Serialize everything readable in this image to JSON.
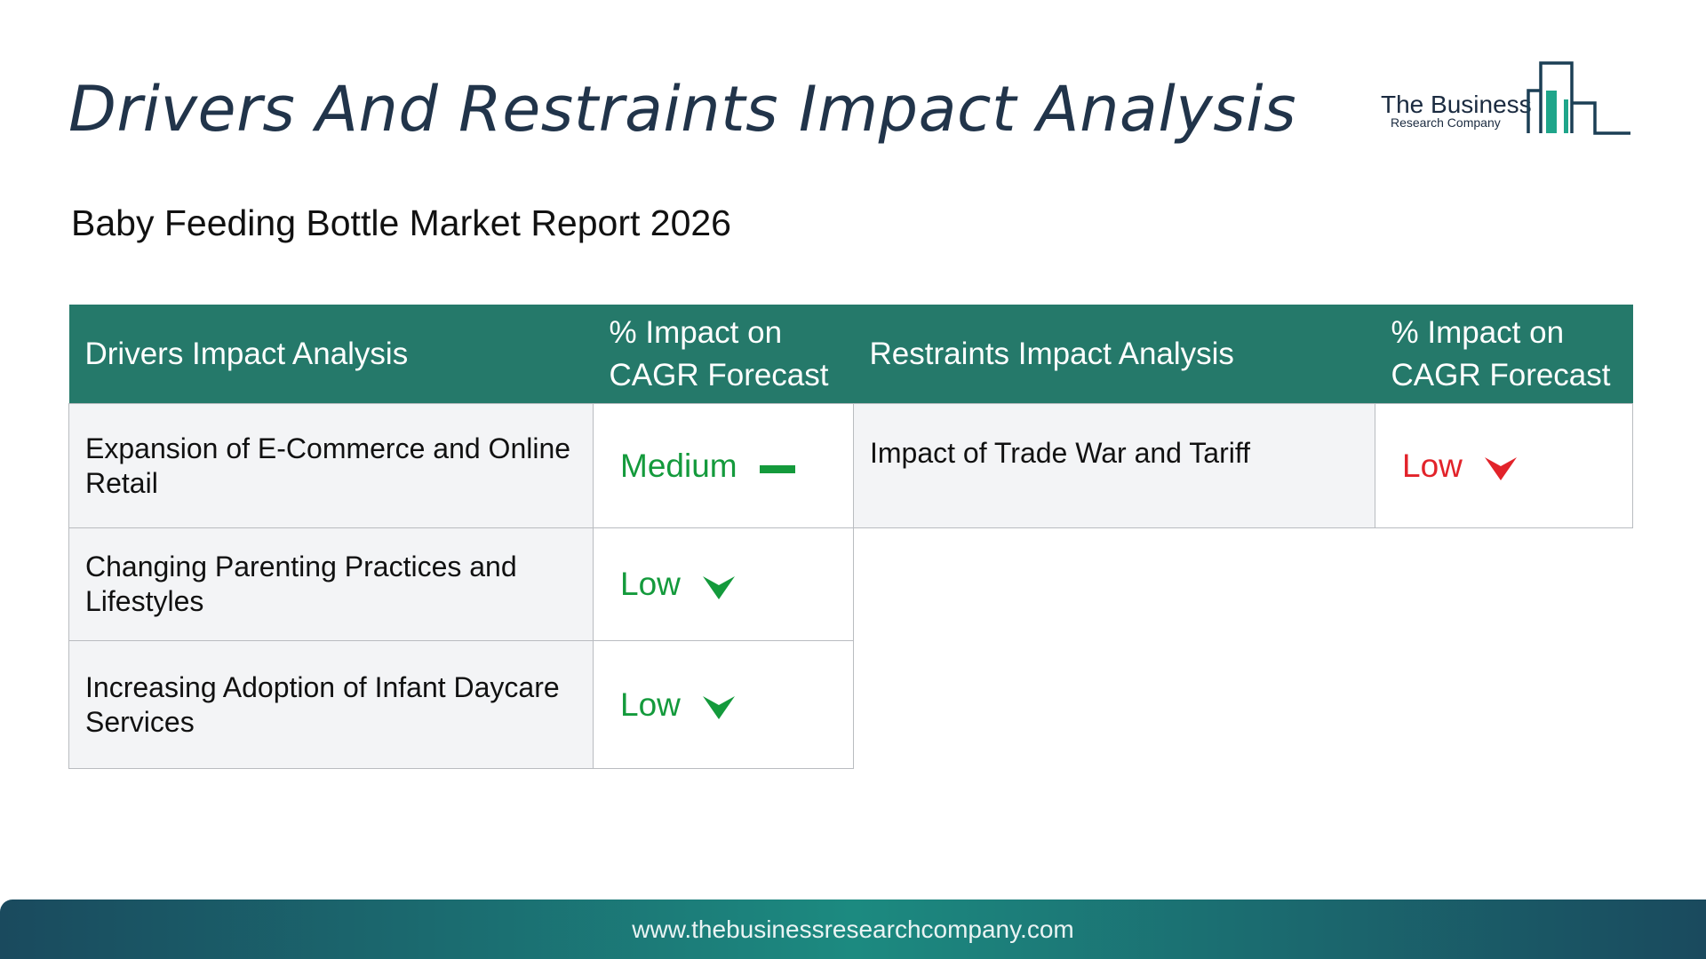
{
  "page_title": "Drivers And Restraints Impact Analysis",
  "subtitle": "Baby Feeding Bottle Market Report 2026",
  "logo": {
    "line1": "The Business",
    "line2": "Research Company"
  },
  "drivers": {
    "header": "Drivers Impact Analysis",
    "impact_header": "% Impact on CAGR Forecast",
    "rows": [
      {
        "factor": "Expansion of E-Commerce and Online Retail",
        "impact": "Medium",
        "indicator": "dash-icon"
      },
      {
        "factor": "Changing Parenting Practices and Lifestyles",
        "impact": "Low",
        "indicator": "arrow-down-icon"
      },
      {
        "factor": "Increasing Adoption of Infant Daycare Services",
        "impact": "Low",
        "indicator": "arrow-down-icon"
      }
    ]
  },
  "restraints": {
    "header": "Restraints Impact Analysis",
    "impact_header": "% Impact on CAGR Forecast",
    "rows": [
      {
        "factor": "Impact of Trade War and Tariff",
        "impact": "Low",
        "indicator": "arrow-down-icon"
      }
    ]
  },
  "colors": {
    "header_bg": "#25796a",
    "title": "#21344a",
    "positive_green": "#149a3c",
    "negative_red": "#e2232a",
    "logo_teal": "#1fa58a"
  },
  "footer": {
    "url": "www.thebusinessresearchcompany.com"
  }
}
